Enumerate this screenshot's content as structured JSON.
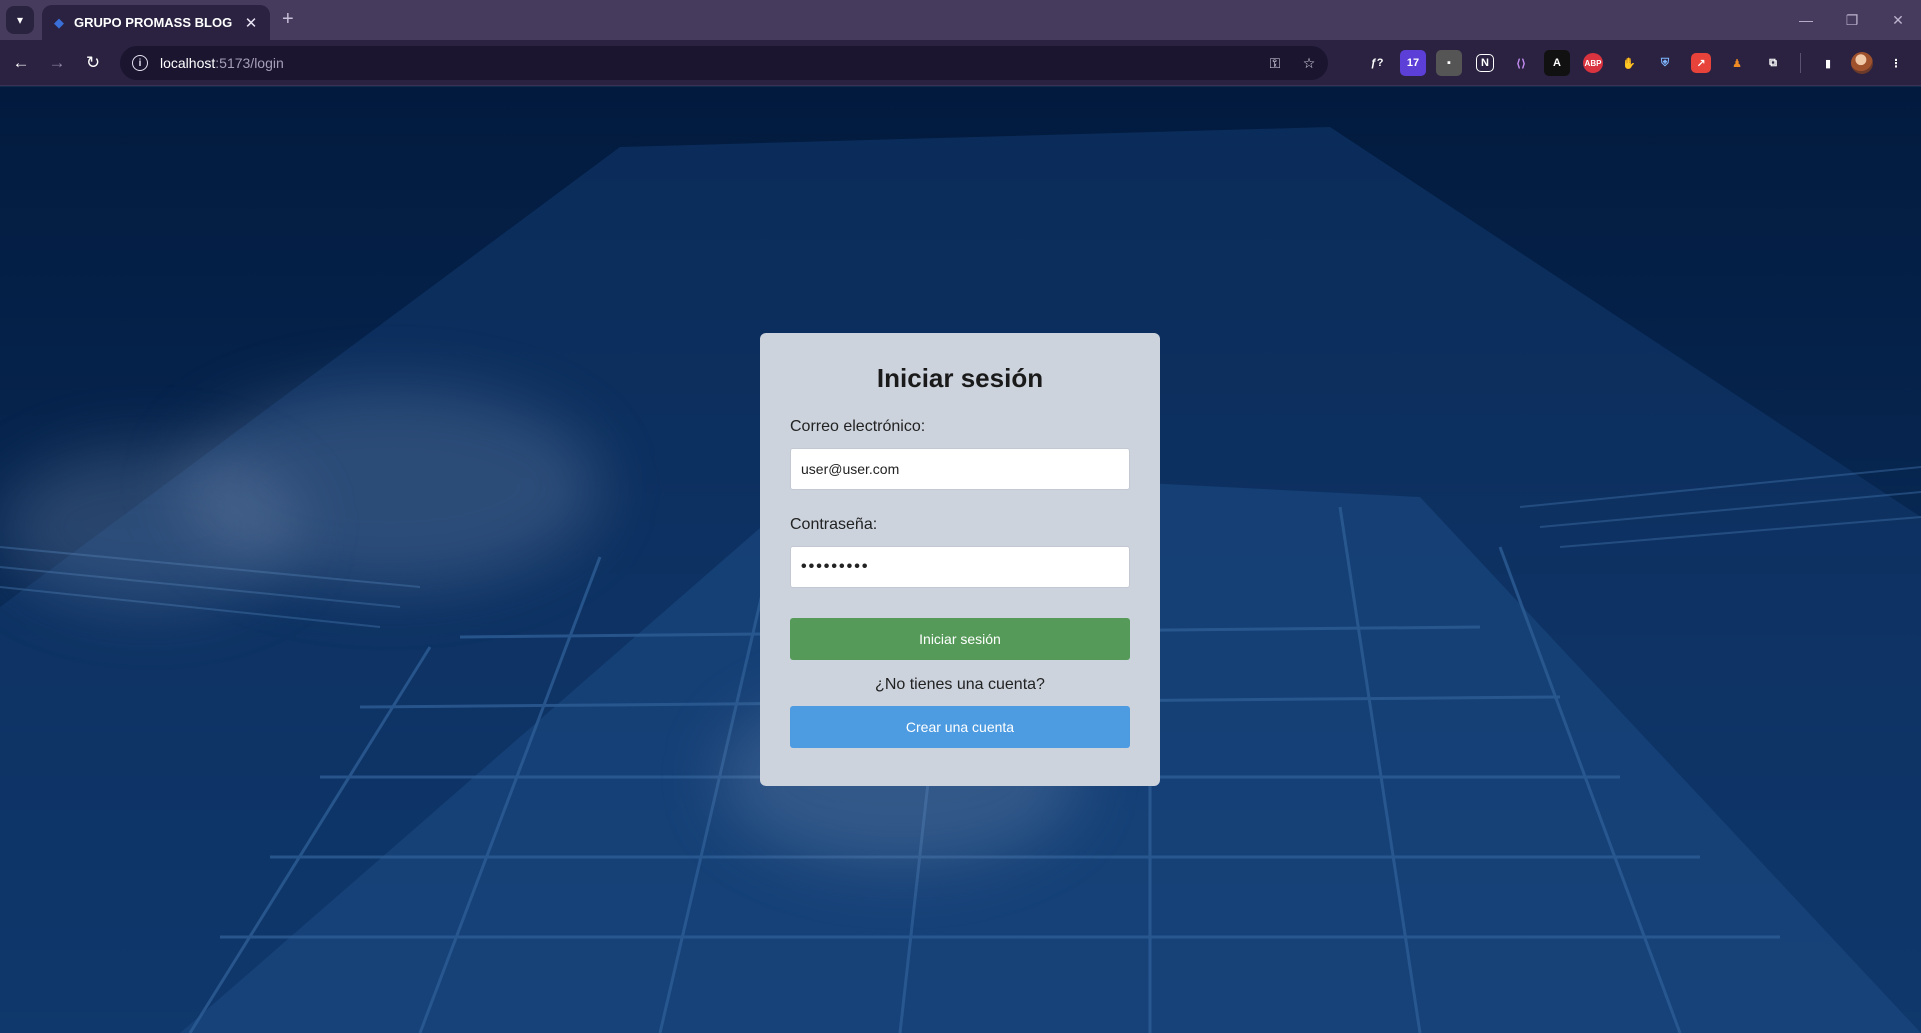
{
  "browser": {
    "tab_title": "GRUPO PROMASS BLOG",
    "tab_close": "✕",
    "new_tab": "+",
    "url_host": "localhost",
    "url_path": ":5173/login",
    "window_controls": [
      "—",
      "❐",
      "✕"
    ]
  },
  "extensions": [
    {
      "name": "fx-extension",
      "label": "ƒ?",
      "color": "#2a2240"
    },
    {
      "name": "calendar-extension",
      "label": "17",
      "color": "#5b3fd6"
    },
    {
      "name": "puzzle-gray-extension",
      "label": "▪",
      "color": "#555"
    },
    {
      "name": "notion-extension",
      "label": "N",
      "color": "#2a2240"
    },
    {
      "name": "brackets-extension",
      "label": "⟨⟩",
      "color": "#2a2240"
    },
    {
      "name": "a-extension",
      "label": "A",
      "color": "#111"
    },
    {
      "name": "adblock-extension",
      "label": "ABP",
      "color": "#d9333f"
    },
    {
      "name": "hand-extension",
      "label": "✋",
      "color": "#d9333f"
    },
    {
      "name": "shield-extension",
      "label": "⛨",
      "color": "#2a2240"
    },
    {
      "name": "red-arrow-extension",
      "label": "↗",
      "color": "#e8433a"
    },
    {
      "name": "person-extension",
      "label": "♟",
      "color": "#f08a24"
    },
    {
      "name": "extensions-puzzle",
      "label": "⧉",
      "color": "#2a2240"
    }
  ],
  "login": {
    "title": "Iniciar sesión",
    "email_label": "Correo electrónico:",
    "email_value": "user@user.com",
    "password_label": "Contraseña:",
    "password_value": "•••••••••",
    "submit_label": "Iniciar sesión",
    "no_account_text": "¿No tienes una cuenta?",
    "create_account_label": "Crear una cuenta"
  },
  "colors": {
    "login_button": "#559a58",
    "create_button": "#4d9be0",
    "card_bg": "#ccd3dd"
  }
}
